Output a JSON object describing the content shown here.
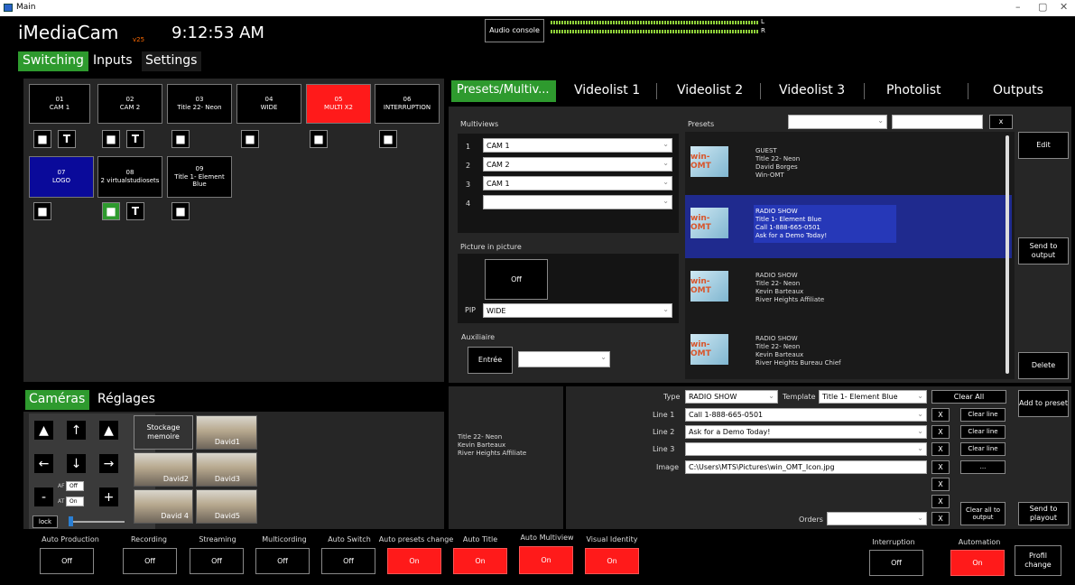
{
  "window": {
    "title": "Main",
    "min": "–",
    "max": "▢",
    "close": "✕"
  },
  "header": {
    "app_name": "iMediaCam",
    "version": "v25",
    "clock": "9:12:53 AM",
    "audio_console": "Audio console",
    "meter_l": "L",
    "meter_r": "R"
  },
  "main_tabs": [
    {
      "label": "Switching"
    },
    {
      "label": "Inputs"
    },
    {
      "label": "Settings"
    }
  ],
  "sources": [
    {
      "num": "01",
      "name": "CAM 1"
    },
    {
      "num": "02",
      "name": "CAM 2"
    },
    {
      "num": "03",
      "name": "Title 22- Neon"
    },
    {
      "num": "04",
      "name": "WIDE"
    },
    {
      "num": "05",
      "name": "MULTI X2"
    },
    {
      "num": "06",
      "name": "INTERRUPTION"
    },
    {
      "num": "07",
      "name": "LOGO"
    },
    {
      "num": "08",
      "name": "2 virtualstudiosets"
    },
    {
      "num": "09",
      "name": "Title 1- Element Blue"
    }
  ],
  "t_label": "T",
  "right_tabs": [
    {
      "label": "Presets/Multiv..."
    },
    {
      "label": "Videolist 1"
    },
    {
      "label": "Videolist 2"
    },
    {
      "label": "Videolist 3"
    },
    {
      "label": "Photolist"
    },
    {
      "label": "Outputs"
    }
  ],
  "multiviews": {
    "title": "Multiviews",
    "rows": [
      {
        "n": "1",
        "value": "CAM 1"
      },
      {
        "n": "2",
        "value": "CAM 2"
      },
      {
        "n": "3",
        "value": "CAM 1"
      },
      {
        "n": "4",
        "value": ""
      }
    ]
  },
  "pip": {
    "title": "Picture in picture",
    "state": "Off",
    "label": "PIP",
    "value": "WIDE"
  },
  "aux": {
    "title": "Auxiliaire",
    "button": "Entrée",
    "value": ""
  },
  "presets": {
    "title": "Presets",
    "filter_value": "",
    "search_value": "",
    "clear": "x",
    "logo_text": "win-OMT",
    "items": [
      {
        "lines": [
          "GUEST",
          "Title 22- Neon",
          "David Borges",
          "Win-OMT"
        ]
      },
      {
        "lines": [
          "RADIO SHOW",
          "Title 1- Element Blue",
          "Call 1-888-665-0501",
          "Ask for a Demo Today!"
        ]
      },
      {
        "lines": [
          "RADIO SHOW",
          "Title 22- Neon",
          "Kevin Barteaux",
          "River Heights Affiliate"
        ]
      },
      {
        "lines": [
          "RADIO SHOW",
          "Title 22- Neon",
          "Kevin Barteaux",
          "River Heights Bureau Chief"
        ]
      }
    ],
    "edit": "Edit",
    "send_output": "Send to output",
    "delete": "Delete"
  },
  "camera_tabs": [
    {
      "label": "Caméras"
    },
    {
      "label": "Réglages"
    }
  ],
  "camera": {
    "storage": "Stockage memoire",
    "af_label": "AF",
    "af_value": "Off",
    "at_label": "AT",
    "at_value": "On",
    "lock": "lock",
    "minus": "-",
    "plus": "+",
    "thumbs": [
      {
        "name": "David1"
      },
      {
        "name": "David2"
      },
      {
        "name": "David3"
      },
      {
        "name": "David 4"
      },
      {
        "name": "David5"
      }
    ]
  },
  "preview_text": [
    "Title 22- Neon",
    "Kevin Barteaux",
    "River Heights Affiliate"
  ],
  "title_editor": {
    "type_label": "Type",
    "type_value": "RADIO SHOW",
    "template_label": "Template",
    "template_value": "Title 1- Element Blue",
    "clear_all": "Clear All",
    "add_preset": "Add to preset",
    "lines": [
      {
        "label": "Line 1",
        "value": "Call 1-888-665-0501"
      },
      {
        "label": "Line 2",
        "value": "Ask for a Demo Today!"
      },
      {
        "label": "Line 3",
        "value": ""
      }
    ],
    "image_label": "Image",
    "image_value": "C:\\Users\\MTS\\Pictures\\win_OMT_Icon.jpg",
    "x": "X",
    "clear_line": "Clear line",
    "browse": "...",
    "clear_all_output": "Clear all to output",
    "orders_label": "Orders",
    "orders_value": "",
    "send_playout": "Send to playout"
  },
  "bottom": {
    "items": [
      {
        "label": "Auto Production",
        "state": "Off"
      },
      {
        "label": "Recording",
        "state": "Off"
      },
      {
        "label": "Streaming",
        "state": "Off"
      },
      {
        "label": "Multicording",
        "state": "Off"
      },
      {
        "label": "Auto Switch",
        "state": "Off"
      },
      {
        "label": "Auto presets change",
        "state": "On"
      },
      {
        "label": "Auto Title",
        "state": "On"
      },
      {
        "label": "Auto Multiview",
        "state": "On"
      },
      {
        "label": "Visual Identity",
        "state": "On"
      }
    ],
    "interruption": {
      "label": "Interruption",
      "state": "Off"
    },
    "automation": {
      "label": "Automation",
      "state": "On"
    },
    "profil": "Profil change"
  },
  "colors": {
    "active_tab": "#2e9a2e",
    "red": "#ff1a1a",
    "blue": "#0a0a9a",
    "selected_preset": "#2638b8",
    "panel": "#262626"
  }
}
